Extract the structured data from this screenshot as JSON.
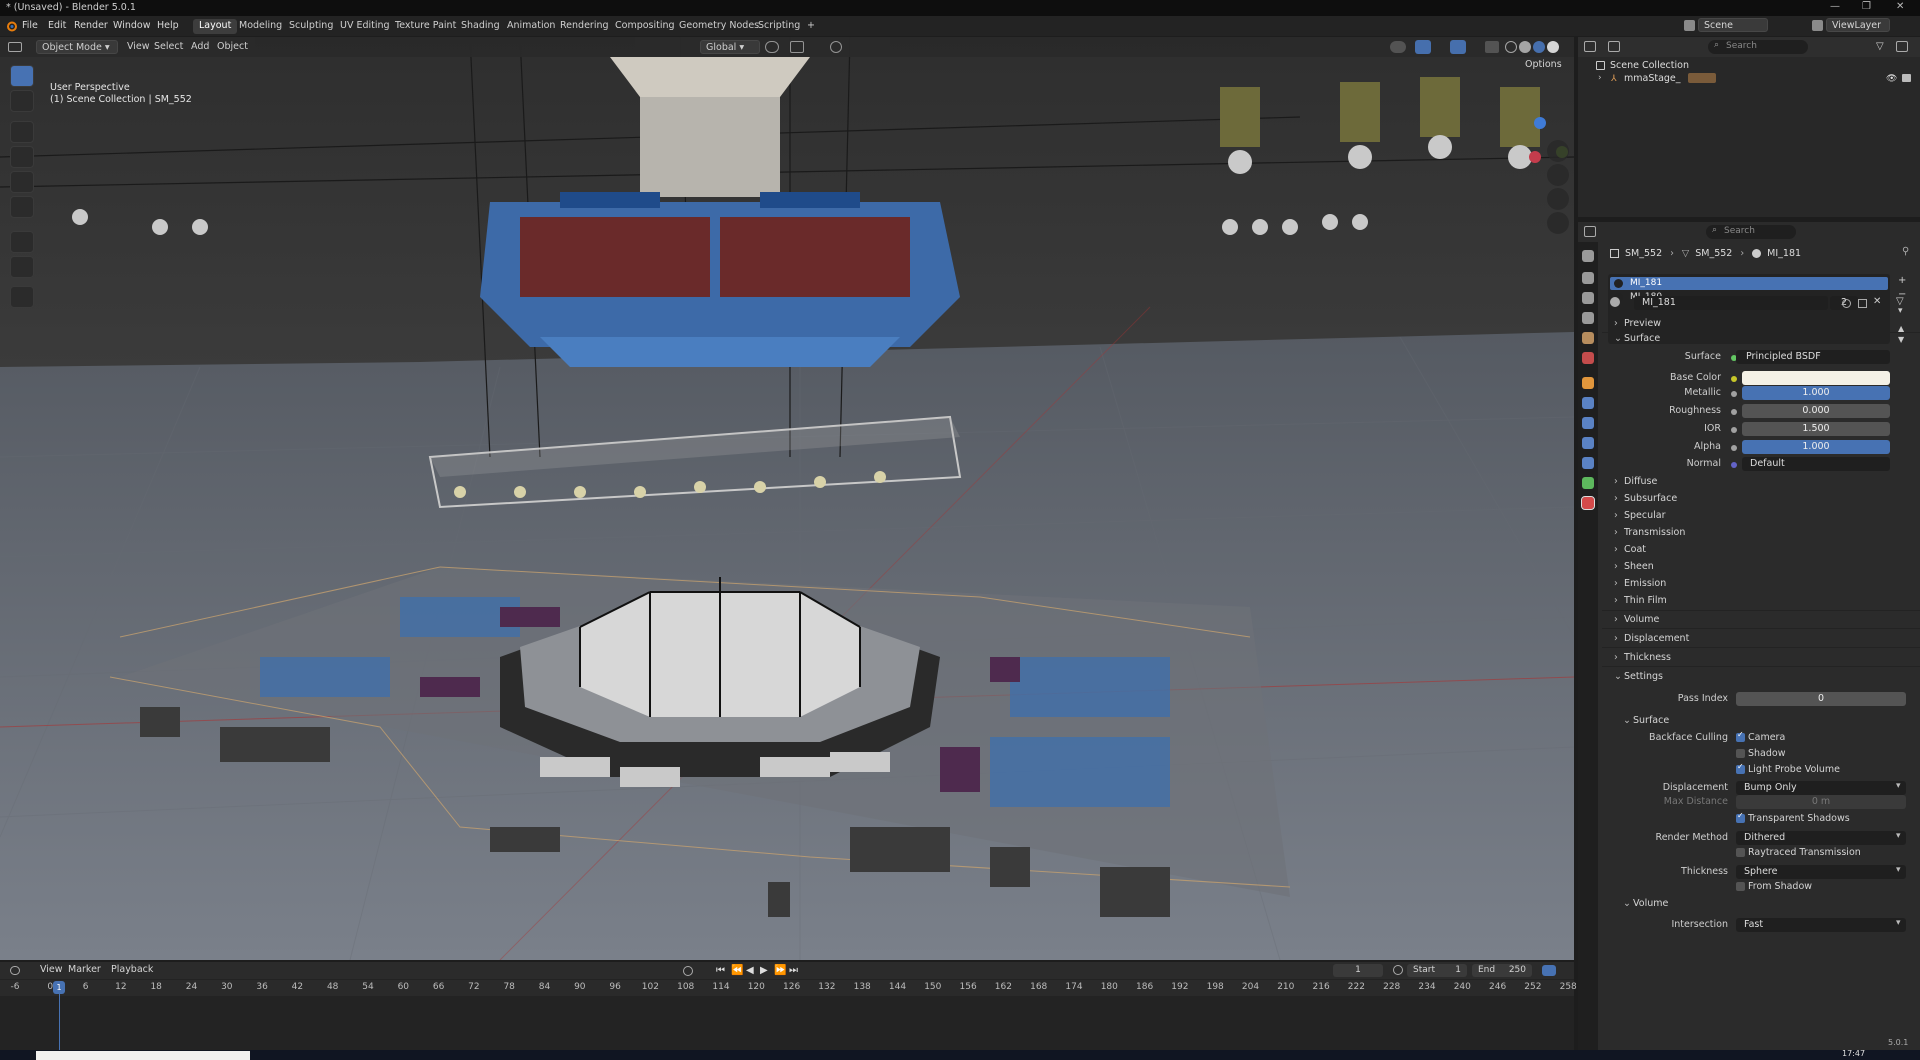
{
  "window": {
    "title": "* (Unsaved) - Blender 5.0.1",
    "controls": [
      "—",
      "❐",
      "✕"
    ]
  },
  "menus": [
    "File",
    "Edit",
    "Render",
    "Window",
    "Help"
  ],
  "workspaces": [
    "Layout",
    "Modeling",
    "Sculpting",
    "UV Editing",
    "Texture Paint",
    "Shading",
    "Animation",
    "Rendering",
    "Compositing",
    "Geometry Nodes",
    "Scripting",
    "+"
  ],
  "scene": {
    "scene_name": "Scene",
    "view_layer": "ViewLayer"
  },
  "viewport": {
    "mode": "Object Mode",
    "menus": [
      "View",
      "Select",
      "Add",
      "Object"
    ],
    "orientation": "Global",
    "options": "Options",
    "overlay_line1": "User Perspective",
    "overlay_line2": "(1) Scene Collection | SM_552"
  },
  "outliner": {
    "search_placeholder": "Search",
    "root": "Scene Collection",
    "child": "mmaStage_"
  },
  "properties": {
    "search_placeholder": "Search",
    "breadcrumb": [
      "SM_552",
      "SM_552",
      "MI_181"
    ],
    "slots": [
      "MI_181",
      "MI_180"
    ],
    "material_name": "MI_181",
    "users": "2",
    "panels": {
      "preview": "Preview",
      "surface": "Surface",
      "volume": "Volume",
      "displacement": "Displacement",
      "thickness": "Thickness",
      "settings": "Settings"
    },
    "surface": {
      "surface_label": "Surface",
      "surface_value": "Principled BSDF",
      "base_color_label": "Base Color",
      "base_color_hex": "#f4f1e6",
      "metallic_label": "Metallic",
      "metallic": "1.000",
      "roughness_label": "Roughness",
      "roughness": "0.000",
      "ior_label": "IOR",
      "ior": "1.500",
      "alpha_label": "Alpha",
      "alpha": "1.000",
      "normal_label": "Normal",
      "normal": "Default"
    },
    "subpanels": [
      "Diffuse",
      "Subsurface",
      "Specular",
      "Transmission",
      "Coat",
      "Sheen",
      "Emission",
      "Thin Film"
    ],
    "settings": {
      "pass_index_label": "Pass Index",
      "pass_index": "0",
      "surface_sub": "Surface",
      "backface_culling_label": "Backface Culling",
      "camera": "Camera",
      "shadow": "Shadow",
      "light_probe_volume": "Light Probe Volume",
      "displacement_label": "Displacement",
      "displacement_value": "Bump Only",
      "max_distance_label": "Max Distance",
      "max_distance": "0 m",
      "transparent_shadows": "Transparent Shadows",
      "render_method_label": "Render Method",
      "render_method": "Dithered",
      "raytraced_transmission": "Raytraced Transmission",
      "thickness_label": "Thickness",
      "thickness_value": "Sphere",
      "from_shadow": "From Shadow",
      "volume_sub": "Volume",
      "intersection_label": "Intersection",
      "intersection_value": "Fast"
    }
  },
  "timeline": {
    "menus": [
      "View",
      "Marker",
      "Playback"
    ],
    "current_frame": "1",
    "start_label": "Start",
    "start": "1",
    "end_label": "End",
    "end": "250",
    "ticks": [
      "-6",
      "0",
      "6",
      "12",
      "18",
      "24",
      "30",
      "36",
      "42",
      "48",
      "54",
      "60",
      "66",
      "72",
      "78",
      "84",
      "90",
      "96",
      "102",
      "108",
      "114",
      "120",
      "126",
      "132",
      "138",
      "144",
      "150",
      "156",
      "162",
      "168",
      "174",
      "180",
      "186",
      "192",
      "198",
      "204",
      "210",
      "216",
      "222",
      "228",
      "234",
      "240",
      "246",
      "252",
      "258"
    ],
    "playhead": "1"
  },
  "statusbar": {
    "version": "5.0.1",
    "clock": "17:47"
  },
  "colors": {
    "accent": "#4772b3",
    "viewport_bg": "#393939",
    "panel_bg": "#2b2b2b"
  }
}
